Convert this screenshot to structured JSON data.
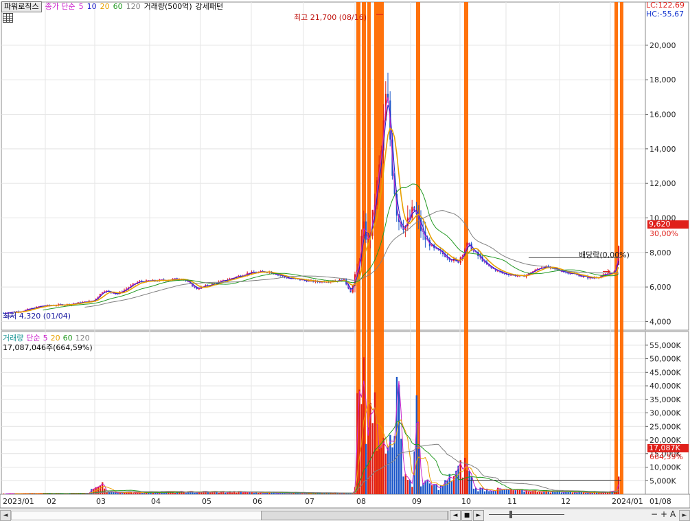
{
  "toolbar": {
    "indicator_button": "파워로직스",
    "ma_label": "종가 단순",
    "ma_periods": [
      {
        "label": "5",
        "color": "#cc22cc"
      },
      {
        "label": "10",
        "color": "#2020cc"
      },
      {
        "label": "20",
        "color": "#e8a000"
      },
      {
        "label": "60",
        "color": "#229922"
      },
      {
        "label": "120",
        "color": "#808080"
      }
    ],
    "volume_label": "거래량(500억)",
    "pattern_label": "강세패턴"
  },
  "price_axis": {
    "lc_label": "LC:122,69",
    "hc_label": "HC:-55,67",
    "ticks": [
      "20,000",
      "18,000",
      "16,000",
      "14,000",
      "12,000",
      "10,000",
      "8,000",
      "6,000",
      "4,000"
    ],
    "current_price": "9,620",
    "current_change": "30,00%"
  },
  "annotations": {
    "high": "최고 21,700 (08/16)",
    "low": "최저 4,320 (01/04)",
    "dividend": "배당락(0,00%)"
  },
  "volume_panel": {
    "label": "거래량",
    "ma_label": "단순",
    "ma_periods": [
      {
        "label": "5",
        "color": "#cc22cc"
      },
      {
        "label": "20",
        "color": "#e8a000"
      },
      {
        "label": "60",
        "color": "#229922"
      },
      {
        "label": "120",
        "color": "#808080"
      }
    ],
    "current_value": "17,087,046주(664,59%)",
    "ticks": [
      "55,000K",
      "50,000K",
      "45,000K",
      "40,000K",
      "35,000K",
      "30,000K",
      "25,000K",
      "20,000K",
      "15,000K",
      "10,000K",
      "5,000K"
    ],
    "current_badge": "17,087K",
    "current_pct": "664,59%"
  },
  "x_axis": {
    "labels": [
      "2023/01",
      "02",
      "03",
      "04",
      "05",
      "06",
      "07",
      "08",
      "09",
      "10",
      "11",
      "12",
      "2024/01",
      "01/08"
    ]
  },
  "scrollbar": {
    "left_arrow": "◄",
    "ctrl_prev": "◄",
    "ctrl_stop": "■",
    "ctrl_next": "►",
    "zoom_minus": "−",
    "zoom_plus": "+",
    "zoom_a": "A",
    "right_arrow": "►"
  },
  "colors": {
    "up": "#e0201a",
    "down": "#1d57c9",
    "highlight": "#ff6a00",
    "ma5": "#cc22cc",
    "ma10": "#2020cc",
    "ma20": "#e8a000",
    "ma60": "#229922",
    "ma120": "#808080"
  },
  "chart_data": {
    "type": "candlestick",
    "price_range": [
      3500,
      22500
    ],
    "volume_range_k": [
      0,
      58000
    ],
    "highlighted_periods": [
      "08 (early)",
      "08 (mid)",
      "09 (early)",
      "10 (early)",
      "2024/01 (early)"
    ],
    "price_series": [
      {
        "date": "2023-01",
        "close": 4700
      },
      {
        "date": "2023-02",
        "close": 5100
      },
      {
        "date": "2023-03",
        "close": 5600
      },
      {
        "date": "2023-04",
        "close": 6400
      },
      {
        "date": "2023-05",
        "close": 6000
      },
      {
        "date": "2023-06",
        "close": 6900
      },
      {
        "date": "2023-07",
        "close": 6200
      },
      {
        "date": "2023-08-early",
        "close": 8500
      },
      {
        "date": "2023-08-16",
        "close": 17500,
        "high": 21700
      },
      {
        "date": "2023-08-late",
        "close": 10500
      },
      {
        "date": "2023-09",
        "close": 9300
      },
      {
        "date": "2023-10",
        "close": 8200
      },
      {
        "date": "2023-11",
        "close": 6900
      },
      {
        "date": "2023-12",
        "close": 6500
      },
      {
        "date": "2024-01-08",
        "close": 9620
      }
    ],
    "volume_peaks_k": [
      {
        "date": "2023-03",
        "value": 7000
      },
      {
        "date": "2023-08-early",
        "value": 55000
      },
      {
        "date": "2023-08-mid",
        "value": 48000
      },
      {
        "date": "2023-09",
        "value": 28000
      },
      {
        "date": "2023-10",
        "value": 11000
      },
      {
        "date": "2024-01-08",
        "value": 17087
      }
    ]
  }
}
